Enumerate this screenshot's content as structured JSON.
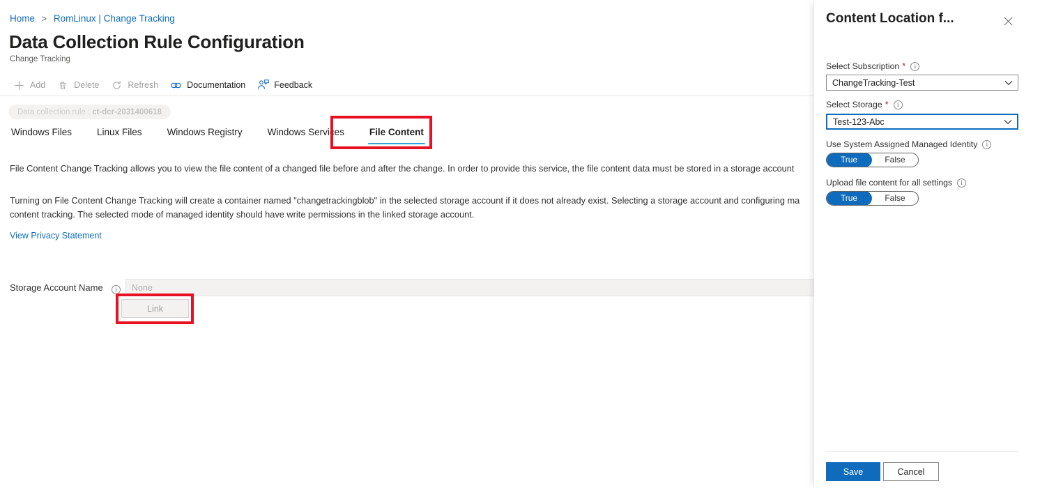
{
  "breadcrumb": {
    "home": "Home",
    "separator": ">",
    "current": "RomLinux | Change Tracking"
  },
  "header": {
    "title": "Data Collection Rule Configuration",
    "ellipsis": "···",
    "subtitle": "Change Tracking"
  },
  "toolbar": {
    "items": [
      {
        "label": "Add",
        "icon": "plus-icon",
        "enabled": false
      },
      {
        "label": "Delete",
        "icon": "trash-icon",
        "enabled": false
      },
      {
        "label": "Refresh",
        "icon": "refresh-icon",
        "enabled": false
      },
      {
        "label": "Documentation",
        "icon": "documentation-icon",
        "enabled": true
      },
      {
        "label": "Feedback",
        "icon": "feedback-icon",
        "enabled": true
      }
    ]
  },
  "dcr_pill": {
    "prefix": "Data collection rule : ",
    "value": "ct-dcr-2031400618"
  },
  "tabs": {
    "items": [
      {
        "label": "Windows Files",
        "active": false
      },
      {
        "label": "Linux Files",
        "active": false
      },
      {
        "label": "Windows Registry",
        "active": false
      },
      {
        "label": "Windows Services",
        "active": false
      },
      {
        "label": "File Content",
        "active": true
      }
    ]
  },
  "content": {
    "paragraph1": "File Content Change Tracking allows you to view the file content of a changed file before and after the change. In order to provide this service, the file content data must be stored in a storage account",
    "paragraph2": "Turning on File Content Change Tracking will create a container named \"changetrackingblob\" in the selected storage account if it does not already exist. Selecting a storage account and configuring ma",
    "paragraph3": "content tracking. The selected mode of managed identity should have write permissions in the linked storage account.",
    "privacy_link": "View Privacy Statement",
    "storage_account_label": "Storage Account Name",
    "storage_account_value": "None",
    "link_button": "Link"
  },
  "panel": {
    "title": "Content Location f...",
    "close_icon": "close-icon",
    "subscription": {
      "label": "Select Subscription",
      "required_marker": "*",
      "value": "ChangeTracking-Test"
    },
    "storage": {
      "label": "Select Storage",
      "required_marker": "*",
      "value": "Test-123-Abc"
    },
    "managed_identity": {
      "label": "Use System Assigned Managed Identity",
      "on_label": "True",
      "off_label": "False",
      "selected": "True"
    },
    "upload_all": {
      "label": "Upload file content for all settings",
      "on_label": "True",
      "off_label": "False",
      "selected": "True"
    },
    "save_label": "Save",
    "cancel_label": "Cancel"
  },
  "colors": {
    "accent_blue": "#0f6cbd",
    "link_blue": "#0f6cbd",
    "tab_underline": "#3b9cdc",
    "annotation_red": "#e81123",
    "required_red": "#a4262c"
  }
}
